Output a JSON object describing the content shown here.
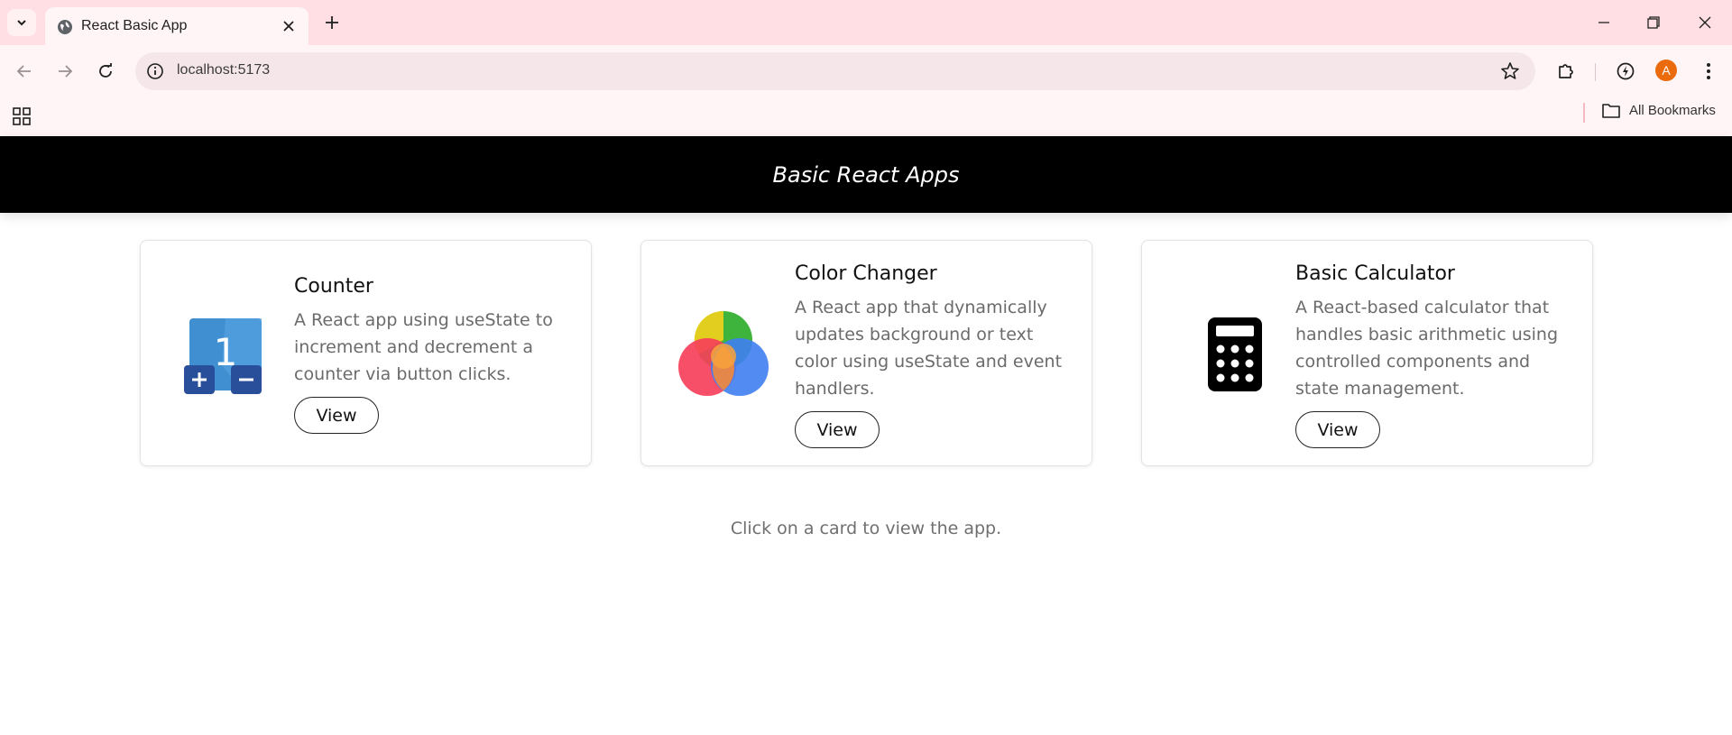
{
  "browser": {
    "tab_title": "React Basic App",
    "url": "localhost:5173",
    "profile_initial": "A",
    "bookmarks_label": "All Bookmarks"
  },
  "header": {
    "title": "Basic React Apps"
  },
  "cards": [
    {
      "title": "Counter",
      "image_icon": "counter-icon",
      "image_number": "1",
      "description": "A React app using useState to increment and decrement a counter via button clicks.",
      "button_label": "View"
    },
    {
      "title": "Color Changer",
      "image_icon": "color-wheel-icon",
      "description": "A React app that dynamically updates background or text color using useState and event handlers.",
      "button_label": "View"
    },
    {
      "title": "Basic Calculator",
      "image_icon": "calculator-icon",
      "description": "A React-based calculator that handles basic arithmetic using controlled components and state management.",
      "button_label": "View"
    }
  ],
  "footer": {
    "hint": "Click on a card to view the app."
  },
  "colors": {
    "tab_strip": "#ffdfe3",
    "toolbar": "#fff5f6",
    "omnibox": "#f5e6e9",
    "header_bg": "#000000",
    "avatar": "#ea6a0c"
  }
}
